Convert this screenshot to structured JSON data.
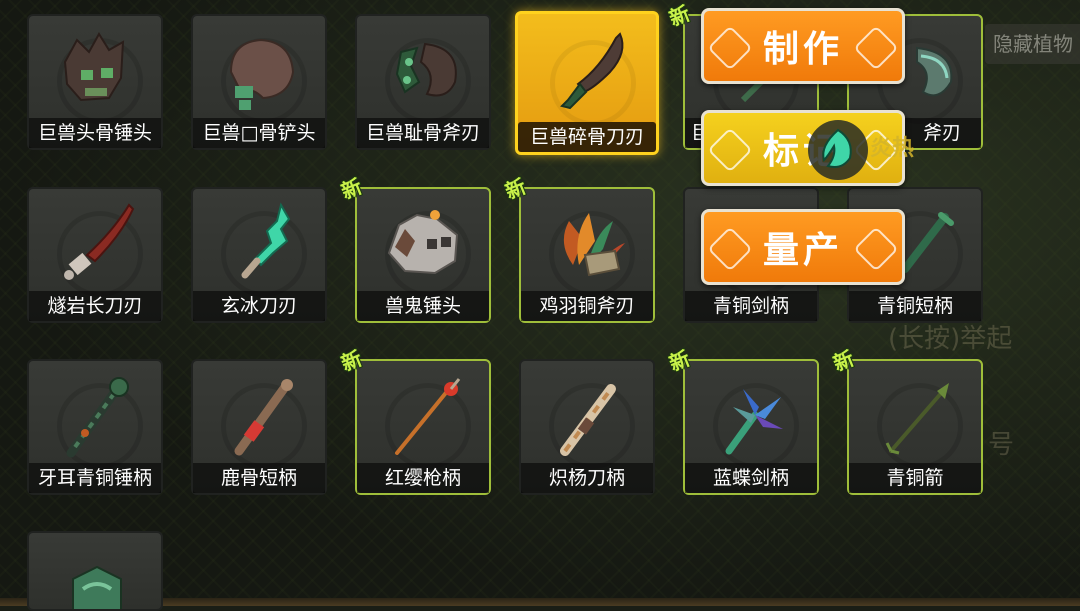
{
  "grid": {
    "items": [
      {
        "label": "巨兽头骨锤头",
        "is_new": false,
        "selected": false,
        "icon": "beast-skull-hammer-icon"
      },
      {
        "label": "巨兽□骨铲头",
        "is_new": false,
        "selected": false,
        "icon": "beast-bone-shovel-icon"
      },
      {
        "label": "巨兽耻骨斧刃",
        "is_new": false,
        "selected": false,
        "icon": "beast-pubic-axe-icon"
      },
      {
        "label": "巨兽碎骨刀刃",
        "is_new": false,
        "selected": true,
        "icon": "beast-bone-blade-icon"
      },
      {
        "label": "巨",
        "is_new": true,
        "selected": false,
        "icon": "partially-hidden-item-icon"
      },
      {
        "label": "斧刃",
        "is_new": false,
        "selected": false,
        "icon": "axe-blade-icon"
      },
      {
        "label": "燧岩长刀刃",
        "is_new": false,
        "selected": false,
        "icon": "flint-long-blade-icon"
      },
      {
        "label": "玄冰刀刃",
        "is_new": false,
        "selected": false,
        "icon": "black-ice-blade-icon"
      },
      {
        "label": "兽鬼锤头",
        "is_new": true,
        "selected": false,
        "icon": "beast-ghost-hammer-icon"
      },
      {
        "label": "鸡羽铜斧刃",
        "is_new": true,
        "selected": false,
        "icon": "feather-bronze-axe-icon"
      },
      {
        "label": "青铜剑柄",
        "is_new": false,
        "selected": false,
        "icon": "bronze-sword-hilt-icon"
      },
      {
        "label": "青铜短柄",
        "is_new": false,
        "selected": false,
        "icon": "bronze-short-handle-icon"
      },
      {
        "label": "牙耳青铜锤柄",
        "is_new": false,
        "selected": false,
        "icon": "bronze-hammer-handle-icon"
      },
      {
        "label": "鹿骨短柄",
        "is_new": false,
        "selected": false,
        "icon": "deer-bone-handle-icon"
      },
      {
        "label": "红缨枪柄",
        "is_new": true,
        "selected": false,
        "icon": "red-tassel-spear-icon"
      },
      {
        "label": "炽杨刀柄",
        "is_new": false,
        "selected": false,
        "icon": "blaze-poplar-hilt-icon"
      },
      {
        "label": "蓝蝶剑柄",
        "is_new": true,
        "selected": false,
        "icon": "blue-butterfly-hilt-icon"
      },
      {
        "label": "青铜箭",
        "is_new": true,
        "selected": false,
        "icon": "bronze-arrow-icon"
      },
      {
        "label": "",
        "is_new": false,
        "selected": false,
        "icon": "jade-item-icon"
      }
    ],
    "new_badge": "新"
  },
  "context_menu": {
    "make_label": "制作",
    "mark_label": "标记",
    "mass_produce_label": "量产"
  },
  "mark_overlay": {
    "icon": "leaf-mark-icon",
    "text": "炎热"
  },
  "background": {
    "tag_text": "隐藏植物",
    "hint_text": "(长按)举起",
    "fragment_text": "号"
  },
  "colors": {
    "selected_accent": "#ffd21e",
    "new_border": "#9fbe3a",
    "new_badge": "#c9f24a",
    "button_orange": "#f7861a",
    "button_yellow": "#ecc21a"
  }
}
